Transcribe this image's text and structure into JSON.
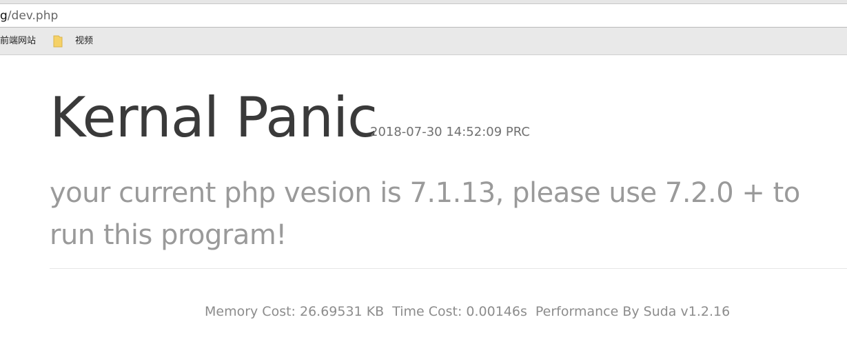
{
  "browser": {
    "address_bar": {
      "url_prefix": "g",
      "url_rest": "/dev.php"
    },
    "bookmarks": [
      {
        "label": "前端网站",
        "icon": null
      },
      {
        "label": "视频",
        "icon": "folder-icon"
      }
    ]
  },
  "page": {
    "title": "Kernal Panic",
    "timestamp": "2018-07-30 14:52:09 PRC",
    "message": "your current php vesion is 7.1.13, please use 7.2.0 + to run this program!",
    "footer": {
      "memory_cost": "Memory Cost: 26.69531 KB",
      "time_cost": "Time Cost: 0.00146s",
      "performance": "Performance By Suda v1.2.16"
    }
  },
  "colors": {
    "title": "#3a3a3a",
    "message": "#9a9a9a",
    "footer": "#8c8c8c",
    "folder_icon": "#f5d167"
  }
}
